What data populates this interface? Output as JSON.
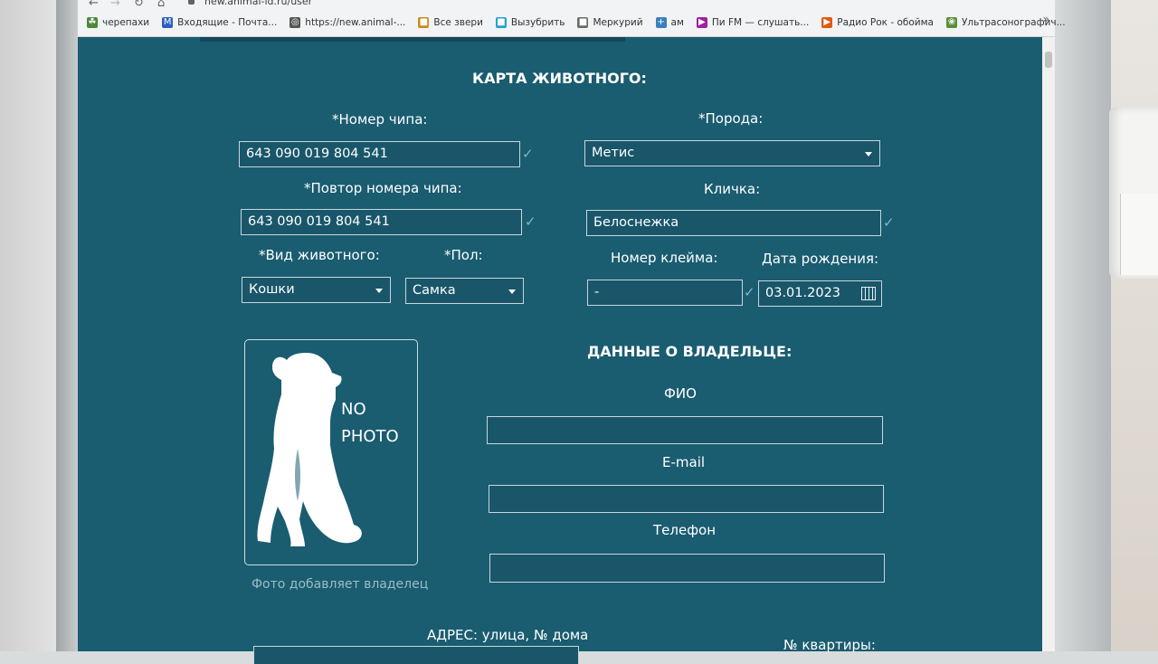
{
  "browser": {
    "url": "new.animal-id.ru/user",
    "bookmarks": [
      {
        "label": "черепахи",
        "icon": "turtle-icon",
        "color": "#4a8a3a"
      },
      {
        "label": "Входящие - Почта...",
        "icon": "mail-icon",
        "color": "#2c5fbf"
      },
      {
        "label": "https://new.animal-...",
        "icon": "globe-icon",
        "color": "#555555"
      },
      {
        "label": "Все звери",
        "icon": "bookmark-icon",
        "color": "#c98b1a"
      },
      {
        "label": "Вызубрить",
        "icon": "bookmark-icon",
        "color": "#2a9fd6"
      },
      {
        "label": "Меркурий",
        "icon": "bookmark-icon",
        "color": "#6b6b6b"
      },
      {
        "label": "ам",
        "icon": "plus-cross-icon",
        "color": "#3a7fbf"
      },
      {
        "label": "Пи FM — слушать...",
        "icon": "radio-icon",
        "color": "#a020a0"
      },
      {
        "label": "Радио Рок - обойма",
        "icon": "play-icon",
        "color": "#e05a10"
      },
      {
        "label": "Ультрасонографич...",
        "icon": "leaf-icon",
        "color": "#5a8f3a"
      }
    ]
  },
  "animal_card": {
    "title": "КАРТА ЖИВОТНОГО:",
    "chip_label": "*Номер чипа:",
    "chip_value": "643 090 019 804 541",
    "chip_repeat_label": "*Повтор номера чипа:",
    "chip_repeat_value": "643 090 019 804 541",
    "species_label": "*Вид животного:",
    "species_value": "Кошки",
    "sex_label": "*Пол:",
    "sex_value": "Самка",
    "breed_label": "*Порода:",
    "breed_value": "Метис",
    "nickname_label": "Кличка:",
    "nickname_value": "Белоснежка",
    "brand_label": "Номер клейма:",
    "brand_value": "-",
    "birth_label": "Дата рождения:",
    "birth_value": "03.01.2023",
    "photo_text_1": "NO",
    "photo_text_2": "PHOTO",
    "photo_caption": "Фото добавляет владелец"
  },
  "owner": {
    "title": "ДАННЫЕ О ВЛАДЕЛЬЦЕ:",
    "name_label": "ФИО",
    "email_label": "E-mail",
    "phone_label": "Телефон",
    "name_value": "",
    "email_value": "",
    "phone_value": ""
  },
  "address": {
    "street_label": "АДРЕС: улица, № дома",
    "apartment_label": "№ квартиры:"
  },
  "colors": {
    "page_bg": "#1a5c70",
    "text": "#ffffff",
    "valid_check": "#7fb9c8"
  }
}
